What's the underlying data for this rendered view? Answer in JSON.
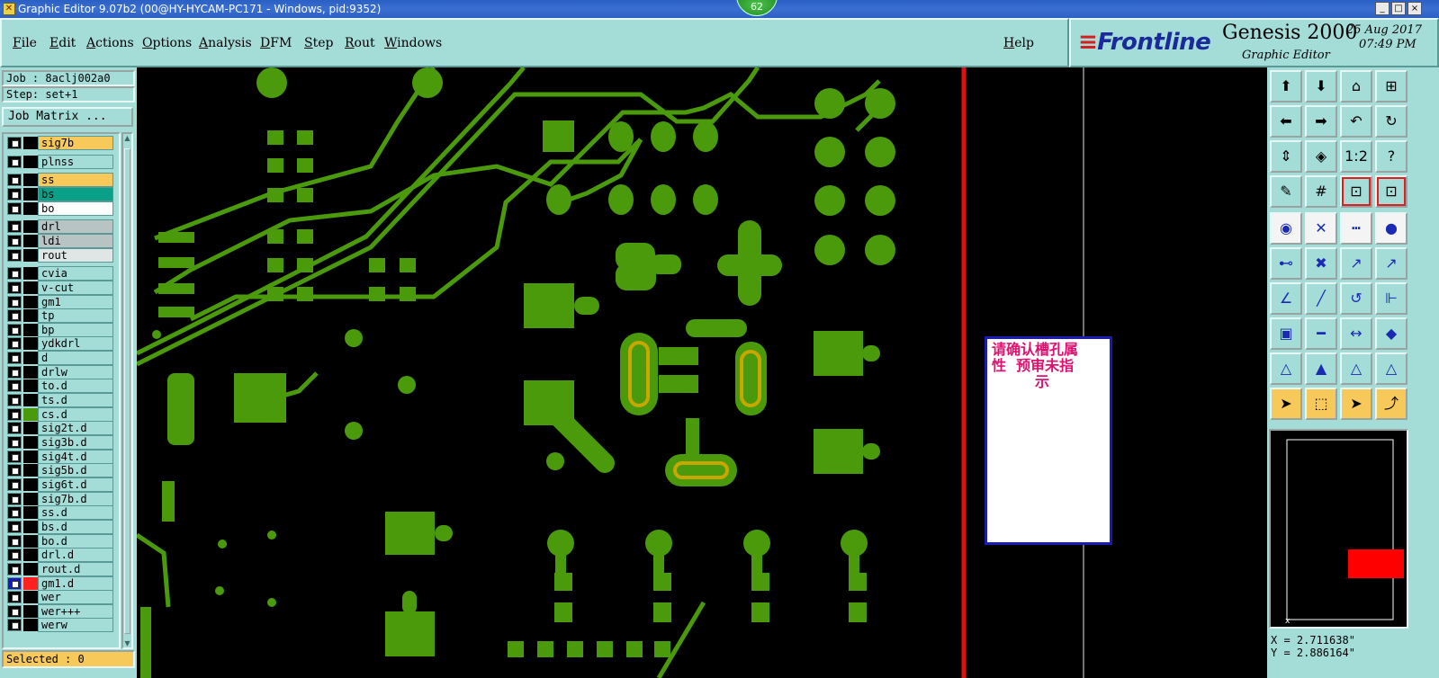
{
  "window": {
    "title": "Graphic Editor 9.07b2 (00@HY-HYCAM-PC171 - Windows, pid:9352)",
    "badge": "62",
    "buttons": [
      "_",
      "□",
      "×"
    ]
  },
  "menu": {
    "items": [
      "File",
      "Edit",
      "Actions",
      "Options",
      "Analysis",
      "DFM",
      "Step",
      "Rout",
      "Windows"
    ],
    "help": "Help"
  },
  "brand": {
    "logo": "Frontline",
    "product": "Genesis 2000",
    "subtitle": "Graphic Editor",
    "date": "25 Aug 2017",
    "time": "07:49 PM"
  },
  "left": {
    "job": "Job : 8aclj002a0",
    "step": "Step: set+1",
    "job_matrix": "Job Matrix ...",
    "selected": "Selected : 0"
  },
  "layers": [
    {
      "name": "sig7b",
      "color": "#f7c85a"
    },
    {
      "name": "plnss",
      "color": "#a4dcd8"
    },
    {
      "name": "ss",
      "color": "#f7c85a"
    },
    {
      "name": "bs",
      "color": "#0aa088"
    },
    {
      "name": "bo",
      "color": "#ffffff"
    },
    {
      "name": "drl",
      "color": "#b8c4c4"
    },
    {
      "name": "ldi",
      "color": "#b8c4c4"
    },
    {
      "name": "rout",
      "color": "#e0e6e6"
    },
    {
      "name": "cvia",
      "color": "#a4dcd8"
    },
    {
      "name": "v-cut",
      "color": "#a4dcd8"
    },
    {
      "name": "gm1",
      "color": "#a4dcd8"
    },
    {
      "name": "tp",
      "color": "#a4dcd8"
    },
    {
      "name": "bp",
      "color": "#a4dcd8"
    },
    {
      "name": "ydkdrl",
      "color": "#a4dcd8"
    },
    {
      "name": "d",
      "color": "#a4dcd8"
    },
    {
      "name": "drlw",
      "color": "#a4dcd8"
    },
    {
      "name": "to.d",
      "color": "#a4dcd8"
    },
    {
      "name": "ts.d",
      "color": "#a4dcd8"
    },
    {
      "name": "cs.d",
      "color": "#a4dcd8"
    },
    {
      "name": "sig2t.d",
      "color": "#a4dcd8"
    },
    {
      "name": "sig3b.d",
      "color": "#a4dcd8"
    },
    {
      "name": "sig4t.d",
      "color": "#a4dcd8"
    },
    {
      "name": "sig5b.d",
      "color": "#a4dcd8"
    },
    {
      "name": "sig6t.d",
      "color": "#a4dcd8"
    },
    {
      "name": "sig7b.d",
      "color": "#a4dcd8"
    },
    {
      "name": "ss.d",
      "color": "#a4dcd8"
    },
    {
      "name": "bs.d",
      "color": "#a4dcd8"
    },
    {
      "name": "bo.d",
      "color": "#a4dcd8"
    },
    {
      "name": "drl.d",
      "color": "#a4dcd8"
    },
    {
      "name": "rout.d",
      "color": "#a4dcd8"
    },
    {
      "name": "gm1.d",
      "color": "#a4dcd8"
    },
    {
      "name": "wer",
      "color": "#a4dcd8"
    },
    {
      "name": "wer+++",
      "color": "#a4dcd8"
    },
    {
      "name": "werw",
      "color": "#a4dcd8"
    }
  ],
  "dialog": {
    "message_line1": "请确认槽孔属",
    "message_line2": "性  预审未指",
    "message_line3": "示"
  },
  "coords": {
    "x": "X = 2.711638\"",
    "y": "Y = 2.886164\""
  },
  "colors": {
    "feature": "#4a9a0c",
    "highlight": "#c8a800",
    "profile": "#e01010"
  }
}
